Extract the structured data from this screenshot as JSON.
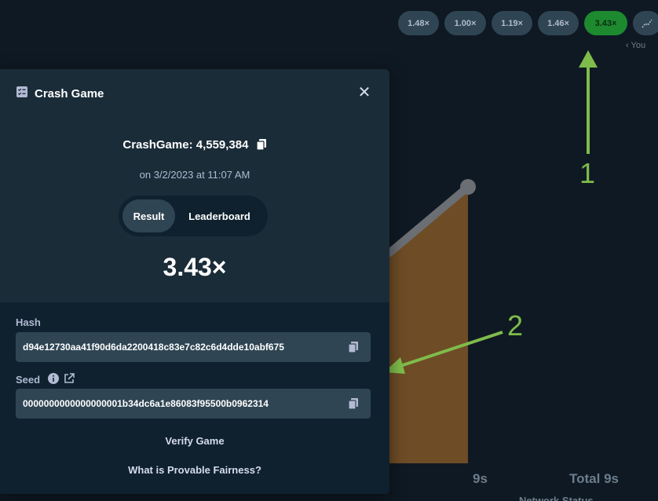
{
  "history": {
    "pills": [
      "1.48×",
      "1.00×",
      "1.19×",
      "1.46×",
      "3.43×"
    ],
    "you_label": "‹ You",
    "chart_icon": "trend-icon"
  },
  "chart": {
    "axis_9s": "9s",
    "axis_total": "Total 9s",
    "network_status": "Network Status",
    "line_color": "#6b6e73",
    "fill_color": "#6e4c26"
  },
  "annotations": {
    "arrow1_label": "1",
    "arrow2_label": "2",
    "color": "#7fbc4b"
  },
  "modal": {
    "title": "Crash Game",
    "game_id": "CrashGame: 4,559,384",
    "date": "on 3/2/2023 at 11:07 AM",
    "tabs": {
      "result": "Result",
      "leaderboard": "Leaderboard"
    },
    "multiplier": "3.43×",
    "hash_label": "Hash",
    "hash_value": "d94e12730aa41f90d6da2200418c83e7c82c6d4dde10abf675",
    "seed_label": "Seed",
    "seed_value": "0000000000000000001b34dc6a1e86083f95500b0962314",
    "verify": "Verify Game",
    "fairness": "What is Provable Fairness?"
  }
}
